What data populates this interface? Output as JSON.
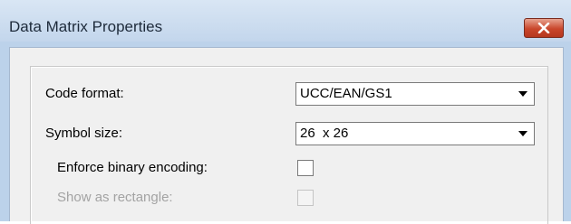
{
  "window": {
    "title": "Data Matrix Properties"
  },
  "form": {
    "code_format": {
      "label": "Code format:",
      "value": "UCC/EAN/GS1"
    },
    "symbol_size": {
      "label": "Symbol size:",
      "value": "26  x 26"
    },
    "enforce_binary": {
      "label": "Enforce binary encoding:",
      "checked": false,
      "enabled": true
    },
    "show_rectangle": {
      "label": "Show as rectangle:",
      "checked": false,
      "enabled": false
    }
  },
  "icons": {
    "close": "close-icon",
    "dropdown": "chevron-down-icon"
  },
  "colors": {
    "close_button": "#c9462b",
    "titlebar": "#c3d6ec",
    "dialog_background": "#f0f0f0",
    "disabled_text": "#a3a3a3"
  }
}
